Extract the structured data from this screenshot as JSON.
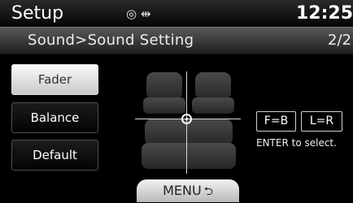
{
  "header": {
    "title": "Setup",
    "time": "12:25",
    "status_icons": "◎ ⇹"
  },
  "subheader": {
    "breadcrumb": "Sound>Sound Setting",
    "page": "2/2"
  },
  "side_menu": {
    "items": [
      "Fader",
      "Balance",
      "Default"
    ],
    "selected": "Fader"
  },
  "settings": {
    "fader_value": "F=B",
    "balance_value": "L=R",
    "hint": "ENTER to select."
  },
  "bottom_tab": {
    "label": "MENU",
    "return_icon": "⮌"
  },
  "colors": {
    "active_button": "#e9e9e9",
    "background": "#000000"
  }
}
